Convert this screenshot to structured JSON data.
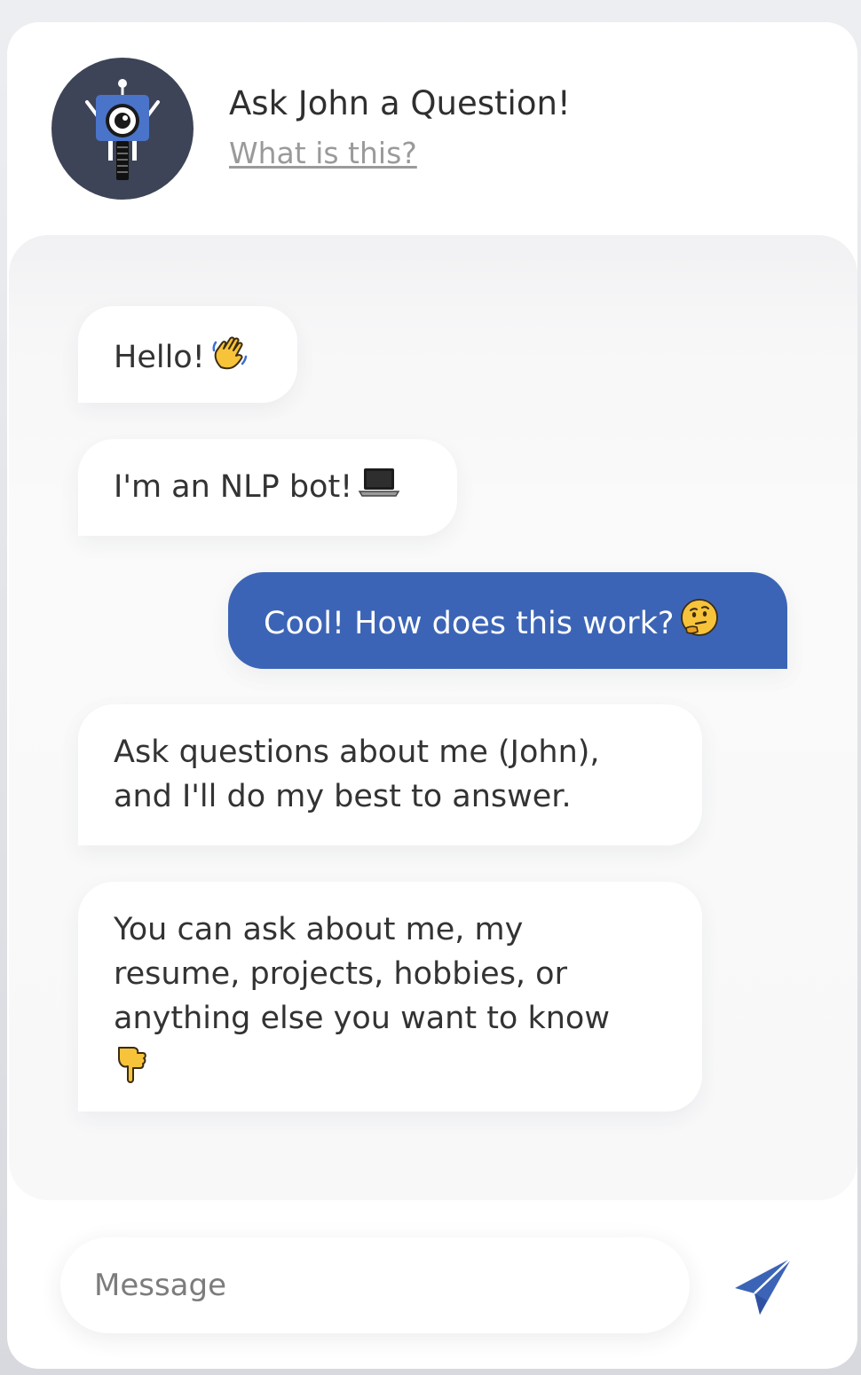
{
  "header": {
    "title": "Ask John a Question!",
    "what_link": "What is this?"
  },
  "messages": [
    {
      "sender": "bot",
      "text": "Hello!",
      "emoji": "waving-hand"
    },
    {
      "sender": "bot",
      "text": "I'm an NLP bot!",
      "emoji": "laptop"
    },
    {
      "sender": "user",
      "text": "Cool! How does this work?",
      "emoji": "thinking-face"
    },
    {
      "sender": "bot",
      "line1": "Ask questions about me (John),",
      "line2": "and I'll do my best to answer."
    },
    {
      "sender": "bot",
      "line1": "You can ask about me, my",
      "line2": "resume, projects, hobbies, or",
      "line3": "anything else you want to know",
      "emoji": "pointing-down"
    }
  ],
  "composer": {
    "placeholder": "Message",
    "value": "",
    "send_icon": "send-icon"
  },
  "colors": {
    "accent": "#3c64b6",
    "avatar_bg": "#3d4457",
    "text": "#333333",
    "muted_link": "#9a9a9a"
  }
}
